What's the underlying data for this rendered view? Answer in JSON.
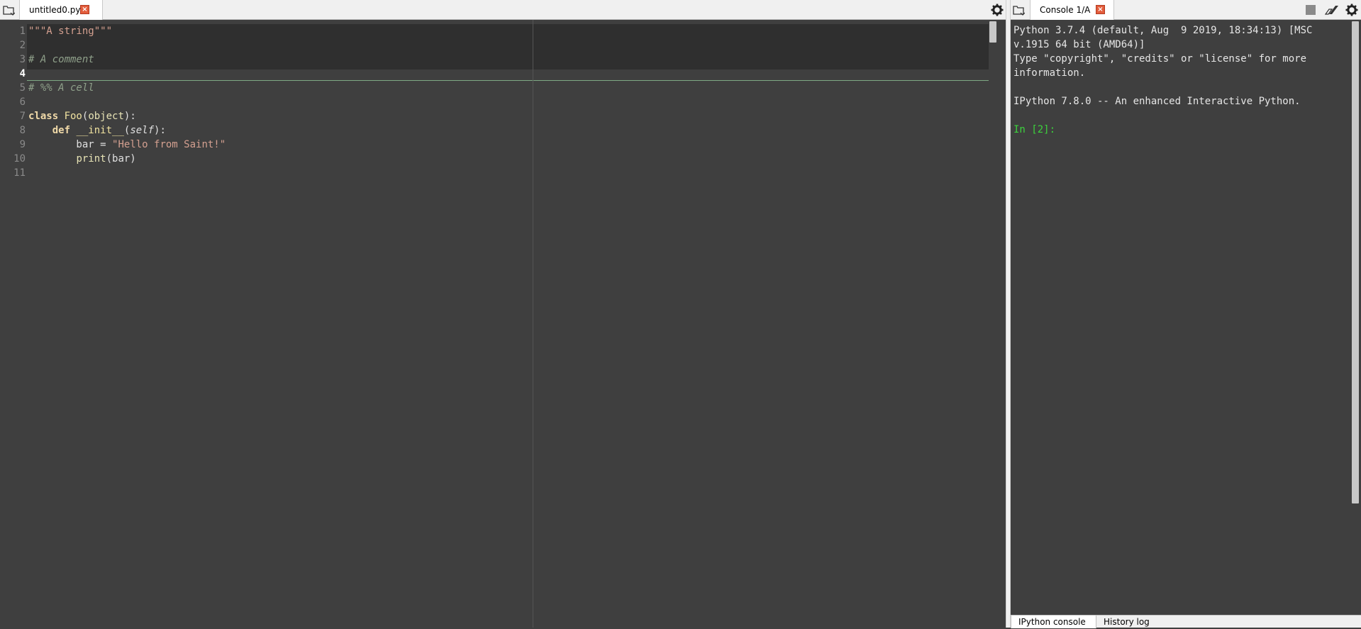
{
  "editor": {
    "tab_label": "untitled0.py",
    "close_label": "×",
    "lines": [
      {
        "no": "1",
        "tokens": [
          {
            "t": "\"\"\"A string\"\"\"",
            "c": "tk-string"
          }
        ]
      },
      {
        "no": "2",
        "tokens": []
      },
      {
        "no": "3",
        "tokens": [
          {
            "t": "# A comment",
            "c": "tk-comment"
          }
        ]
      },
      {
        "no": "4",
        "tokens": [],
        "current": true
      },
      {
        "no": "5",
        "tokens": [
          {
            "t": "# %% A cell",
            "c": "tk-comment"
          }
        ]
      },
      {
        "no": "6",
        "tokens": []
      },
      {
        "no": "7",
        "tokens": [
          {
            "t": "class ",
            "c": "tk-keyword"
          },
          {
            "t": "Foo",
            "c": "tk-def"
          },
          {
            "t": "(",
            "c": ""
          },
          {
            "t": "object",
            "c": "tk-builtin"
          },
          {
            "t": "):",
            "c": ""
          }
        ]
      },
      {
        "no": "8",
        "tokens": [
          {
            "t": "    ",
            "c": ""
          },
          {
            "t": "def ",
            "c": "tk-keyword"
          },
          {
            "t": "__init__",
            "c": "tk-def"
          },
          {
            "t": "(",
            "c": ""
          },
          {
            "t": "self",
            "c": "tk-self"
          },
          {
            "t": "):",
            "c": ""
          }
        ]
      },
      {
        "no": "9",
        "tokens": [
          {
            "t": "        bar = ",
            "c": ""
          },
          {
            "t": "\"Hello from Saint!\"",
            "c": "tk-string"
          }
        ]
      },
      {
        "no": "10",
        "tokens": [
          {
            "t": "        ",
            "c": ""
          },
          {
            "t": "print",
            "c": "tk-builtin"
          },
          {
            "t": "(bar)",
            "c": ""
          }
        ]
      },
      {
        "no": "11",
        "tokens": []
      }
    ]
  },
  "console": {
    "tab_label": "Console 1/A",
    "close_label": "×",
    "output_lines": [
      "Python 3.7.4 (default, Aug  9 2019, 18:34:13) [MSC",
      "v.1915 64 bit (AMD64)]",
      "Type \"copyright\", \"credits\" or \"license\" for more",
      "information.",
      "",
      "IPython 7.8.0 -- An enhanced Interactive Python.",
      ""
    ],
    "prompt": "In [2]:",
    "bottom_tabs": [
      "IPython console",
      "History log"
    ]
  },
  "colors": {
    "background": "#3f3f3f",
    "cell_highlight": "#2f2f2f",
    "prompt": "#3cd33c",
    "close_button": "#e35d3c"
  },
  "icons": {
    "browse_tabs": "browse-tabs-icon",
    "options": "gear-icon",
    "stop": "stop-icon",
    "clear": "eraser-icon"
  }
}
